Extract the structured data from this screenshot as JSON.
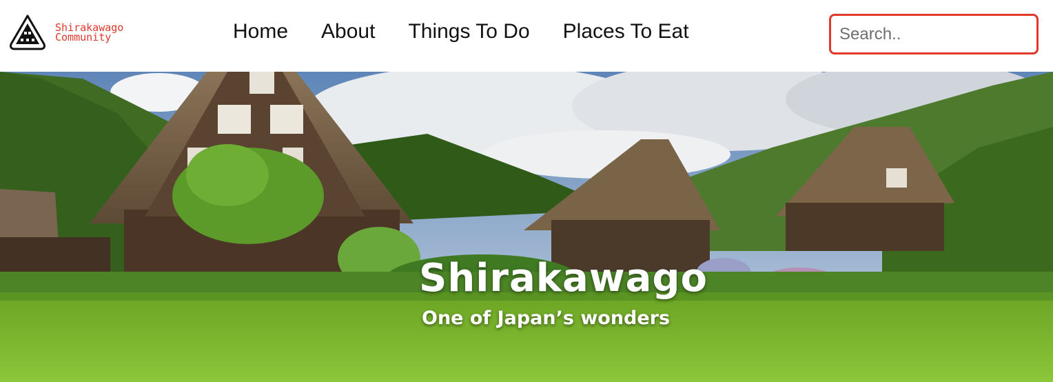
{
  "header": {
    "logo": {
      "line1": "Shirakawago",
      "line2": "Community"
    },
    "nav": [
      {
        "label": "Home"
      },
      {
        "label": "About"
      },
      {
        "label": "Things To Do"
      },
      {
        "label": "Places To Eat"
      }
    ],
    "search": {
      "placeholder": "Search..",
      "value": ""
    }
  },
  "hero": {
    "title": "Shirakawago",
    "subtitle": "One of Japan’s wonders",
    "image": "shirakawago-village-photo"
  },
  "colors": {
    "accent": "#e0392b",
    "nav_text": "#111111"
  }
}
